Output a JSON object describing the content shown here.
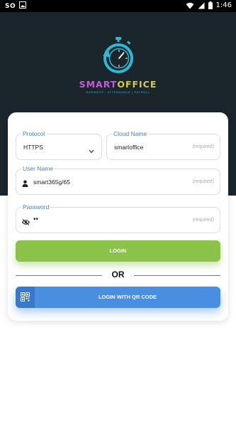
{
  "statusbar": {
    "carrier": "SO",
    "time": "1:46",
    "icons": [
      "image-icon",
      "wifi-icon",
      "mobile-signal-icon",
      "battery-icon"
    ]
  },
  "brand": {
    "name_part1": "SMART",
    "name_part2": "OFFICE",
    "tagline": "BUSINESS - ATTENDANCE | PAYROLL",
    "colors": {
      "primary": "#c25edb",
      "secondary": "#d9c84a",
      "icon": "#2fb8d6"
    }
  },
  "form": {
    "protocol": {
      "label": "Protocol",
      "value": "HTTPS"
    },
    "cloud_name": {
      "label": "Cloud Name",
      "value": "smartoffice",
      "hint": "(required)"
    },
    "username": {
      "label": "User Name",
      "value": "smart365g/65",
      "hint": "(required)"
    },
    "password": {
      "label": "Password",
      "value": "••",
      "hint": "(required)"
    },
    "login_label": "LOGIN",
    "or_label": "OR",
    "qr_login_label": "LOGIN WITH QR CODE"
  },
  "colors": {
    "header_bg": "#1a262c",
    "accent_label": "#3a86d6",
    "login_button": "#8bc34a",
    "qr_button": "#4a8ee2"
  }
}
